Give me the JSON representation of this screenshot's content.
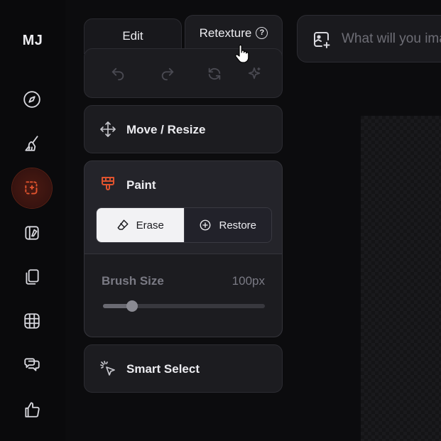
{
  "app": {
    "logo": "MJ"
  },
  "sidebar": {
    "items": [
      {
        "icon": "compass-icon",
        "label": "Explore"
      },
      {
        "icon": "brush-icon",
        "label": "Create"
      },
      {
        "icon": "edit-selection-icon",
        "label": "Edit",
        "active": true
      },
      {
        "icon": "style-icon",
        "label": "Style"
      },
      {
        "icon": "copy-icon",
        "label": "Organize"
      },
      {
        "icon": "grid-icon",
        "label": "Gallery"
      },
      {
        "icon": "chat-icon",
        "label": "Chat"
      },
      {
        "icon": "thumbs-up-icon",
        "label": "Rate"
      }
    ],
    "accent_color": "#e0532e"
  },
  "tabs": {
    "edit_label": "Edit",
    "retexture_label": "Retexture",
    "help_icon": "help-circle-icon",
    "help_glyph": "?"
  },
  "toolbar": {
    "undo_icon": "undo-icon",
    "redo_icon": "redo-icon",
    "reset_icon": "refresh-icon",
    "magic_icon": "sparkle-icon"
  },
  "move_resize": {
    "label": "Move / Resize",
    "icon": "move-arrows-icon"
  },
  "paint": {
    "label": "Paint",
    "icon": "paint-brush-icon",
    "erase_label": "Erase",
    "restore_label": "Restore",
    "selected_mode": "Erase",
    "brush_size_label": "Brush Size",
    "brush_size_value": "100px",
    "brush_size_fraction": 0.18
  },
  "smart_select": {
    "label": "Smart Select",
    "icon": "cursor-click-icon"
  },
  "prompt": {
    "placeholder": "What will you imagine?",
    "icon": "image-add-icon"
  }
}
